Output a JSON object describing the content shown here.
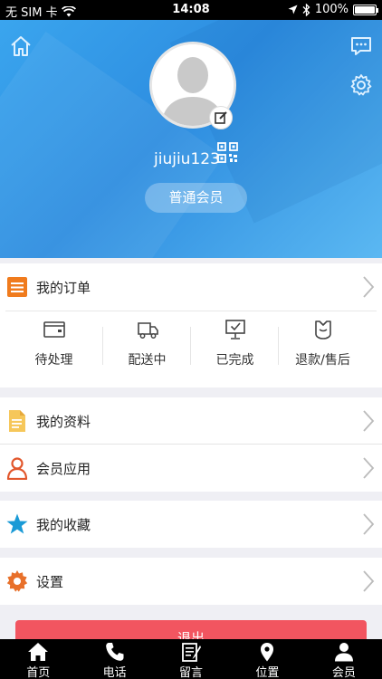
{
  "status_bar": {
    "carrier": "无 SIM 卡",
    "time": "14:08",
    "battery": "100%"
  },
  "profile": {
    "username": "jiujiu123",
    "member_level": "普通会员"
  },
  "orders": {
    "title": "我的订单",
    "statuses": [
      {
        "label": "待处理",
        "icon": "wallet-icon"
      },
      {
        "label": "配送中",
        "icon": "truck-icon"
      },
      {
        "label": "已完成",
        "icon": "monitor-check-icon"
      },
      {
        "label": "退款/售后",
        "icon": "refund-icon"
      }
    ]
  },
  "menu": {
    "profile": "我的资料",
    "member_apps": "会员应用",
    "favorites": "我的收藏",
    "settings": "设置"
  },
  "logout_label": "退出",
  "tabs": [
    {
      "label": "首页",
      "icon": "home-icon"
    },
    {
      "label": "电话",
      "icon": "phone-icon"
    },
    {
      "label": "留言",
      "icon": "message-icon"
    },
    {
      "label": "位置",
      "icon": "location-icon"
    },
    {
      "label": "会员",
      "icon": "member-icon"
    }
  ],
  "colors": {
    "header_blue": "#2d8de0",
    "logout_red": "#f25560",
    "orders_orange": "#f07b1d",
    "favorite_blue": "#1a9ad6",
    "settings_orange": "#e8702a"
  }
}
